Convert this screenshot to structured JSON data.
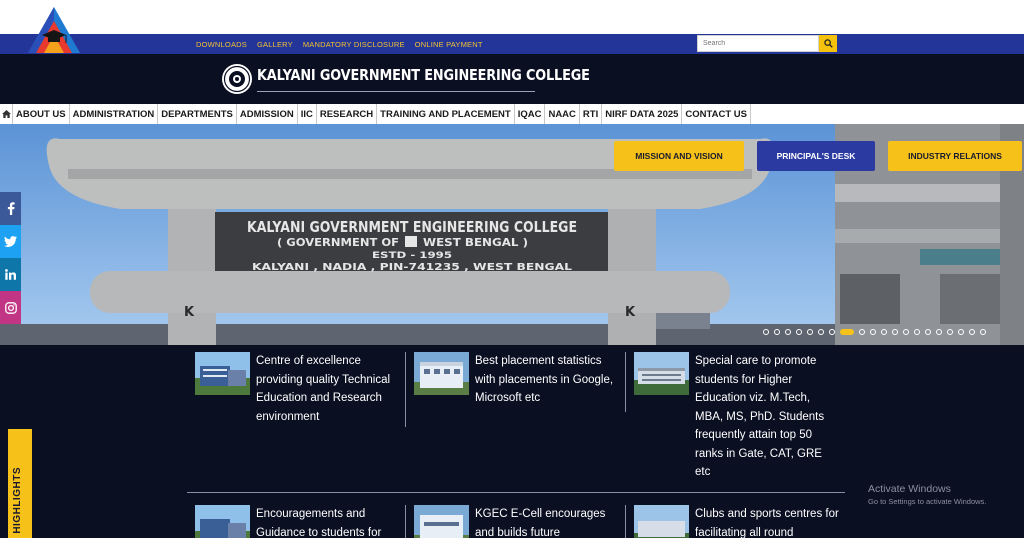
{
  "utility": {
    "links": [
      "DOWNLOADS",
      "GALLERY",
      "MANDATORY DISCLOSURE",
      "ONLINE PAYMENT"
    ],
    "search_placeholder": "Search"
  },
  "banner": {
    "college_name": "KALYANI GOVERNMENT ENGINEERING COLLEGE"
  },
  "nav": {
    "items": [
      "ABOUT US",
      "ADMINISTRATION",
      "DEPARTMENTS",
      "ADMISSION",
      "IIC",
      "RESEARCH",
      "TRAINING AND PLACEMENT",
      "IQAC",
      "NAAC",
      "RTI",
      "NIRF DATA 2025",
      "CONTACT US"
    ]
  },
  "hero": {
    "gate_line1": "KALYANI GOVERNMENT ENGINEERING COLLEGE",
    "gate_line2a": "( GOVERNMENT OF",
    "gate_line2b": "WEST BENGAL )",
    "gate_line3": "ESTD - 1995",
    "gate_line4": "KALYANI , NADIA , PIN-741235 , WEST BENGAL",
    "quick_links": [
      "MISSION AND VISION",
      "PRINCIPAL'S DESK",
      "INDUSTRY RELATIONS"
    ],
    "slider": {
      "total": 20,
      "active": 7
    }
  },
  "features": [
    "Centre of excellence providing quality Technical Education and Research environment",
    "Best placement statistics with placements in Google, Microsoft etc",
    "Special care to promote students for Higher Education viz. M.Tech, MBA, MS, PhD. Students frequently attain top 50 ranks in Gate, CAT, GRE etc",
    "Encouragements and Guidance to students for",
    "KGEC E-Cell encourages and builds future",
    "Clubs and sports centres for facilitating all round"
  ],
  "highlights_label": "HIGHLIGHTS",
  "watermark": {
    "title": "Activate Windows",
    "subtitle": "Go to Settings to activate Windows."
  },
  "colors": {
    "utility_bar": "#24359a",
    "banner": "#0b0f22",
    "accent_yellow": "#f6c21a",
    "accent_blue": "#2b3aa0"
  }
}
